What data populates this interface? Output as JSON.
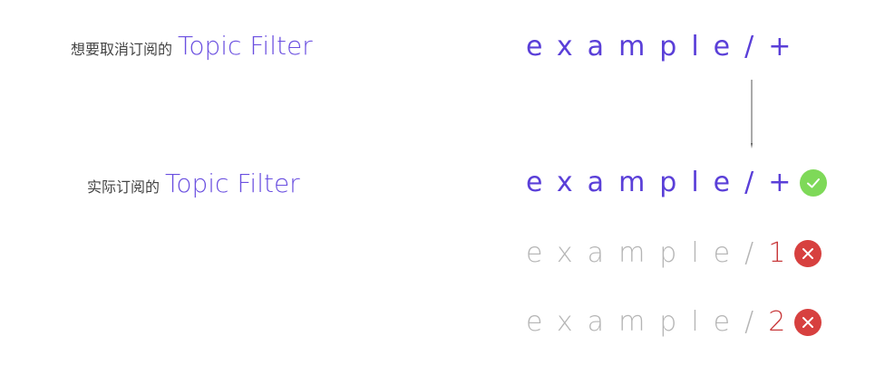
{
  "header": {
    "cn": "想要取消订阅的",
    "en": "Topic Filter"
  },
  "actual": {
    "cn": "实际订阅的",
    "en": "Topic Filter"
  },
  "filter": {
    "prefix": "example/",
    "wildcard": "+"
  },
  "topics": [
    {
      "prefix": "example/",
      "suffix": "+",
      "match": "check-icon"
    },
    {
      "prefix": "example/",
      "suffix": "1",
      "match": "cross-icon"
    },
    {
      "prefix": "example/",
      "suffix": "2",
      "match": "cross-icon"
    }
  ],
  "colors": {
    "accent": "#5a3fd8",
    "muted": "#b5b5b5",
    "error": "#c8393b",
    "success": "#7ed958"
  }
}
